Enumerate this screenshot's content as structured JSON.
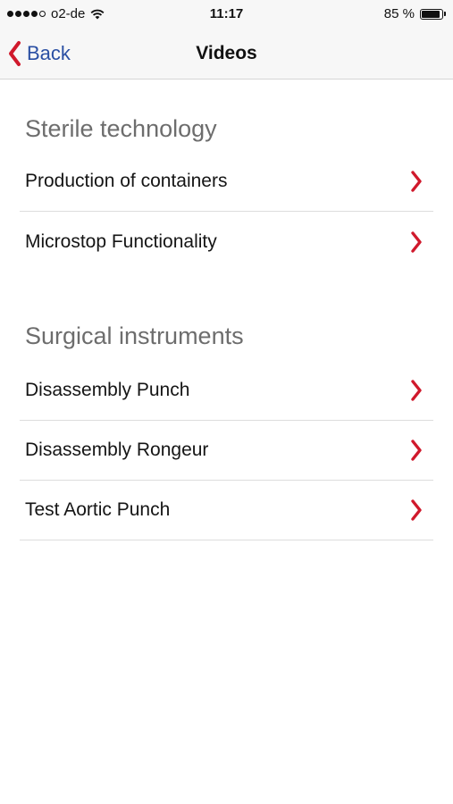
{
  "status_bar": {
    "carrier": "o2-de",
    "time": "11:17",
    "battery_percent": "85 %",
    "signal_icon": "signal-dots-icon",
    "wifi_icon": "wifi-icon",
    "battery_icon": "battery-icon"
  },
  "nav": {
    "back_label": "Back",
    "title": "Videos",
    "back_color": "#2a4fa3",
    "chevron_color": "#d0192c"
  },
  "sections": [
    {
      "header": "Sterile technology",
      "items": [
        {
          "label": "Production of containers"
        },
        {
          "label": "Microstop Functionality"
        }
      ]
    },
    {
      "header": "Surgical instruments",
      "items": [
        {
          "label": "Disassembly Punch"
        },
        {
          "label": "Disassembly Rongeur"
        },
        {
          "label": "Test Aortic Punch"
        }
      ]
    }
  ]
}
